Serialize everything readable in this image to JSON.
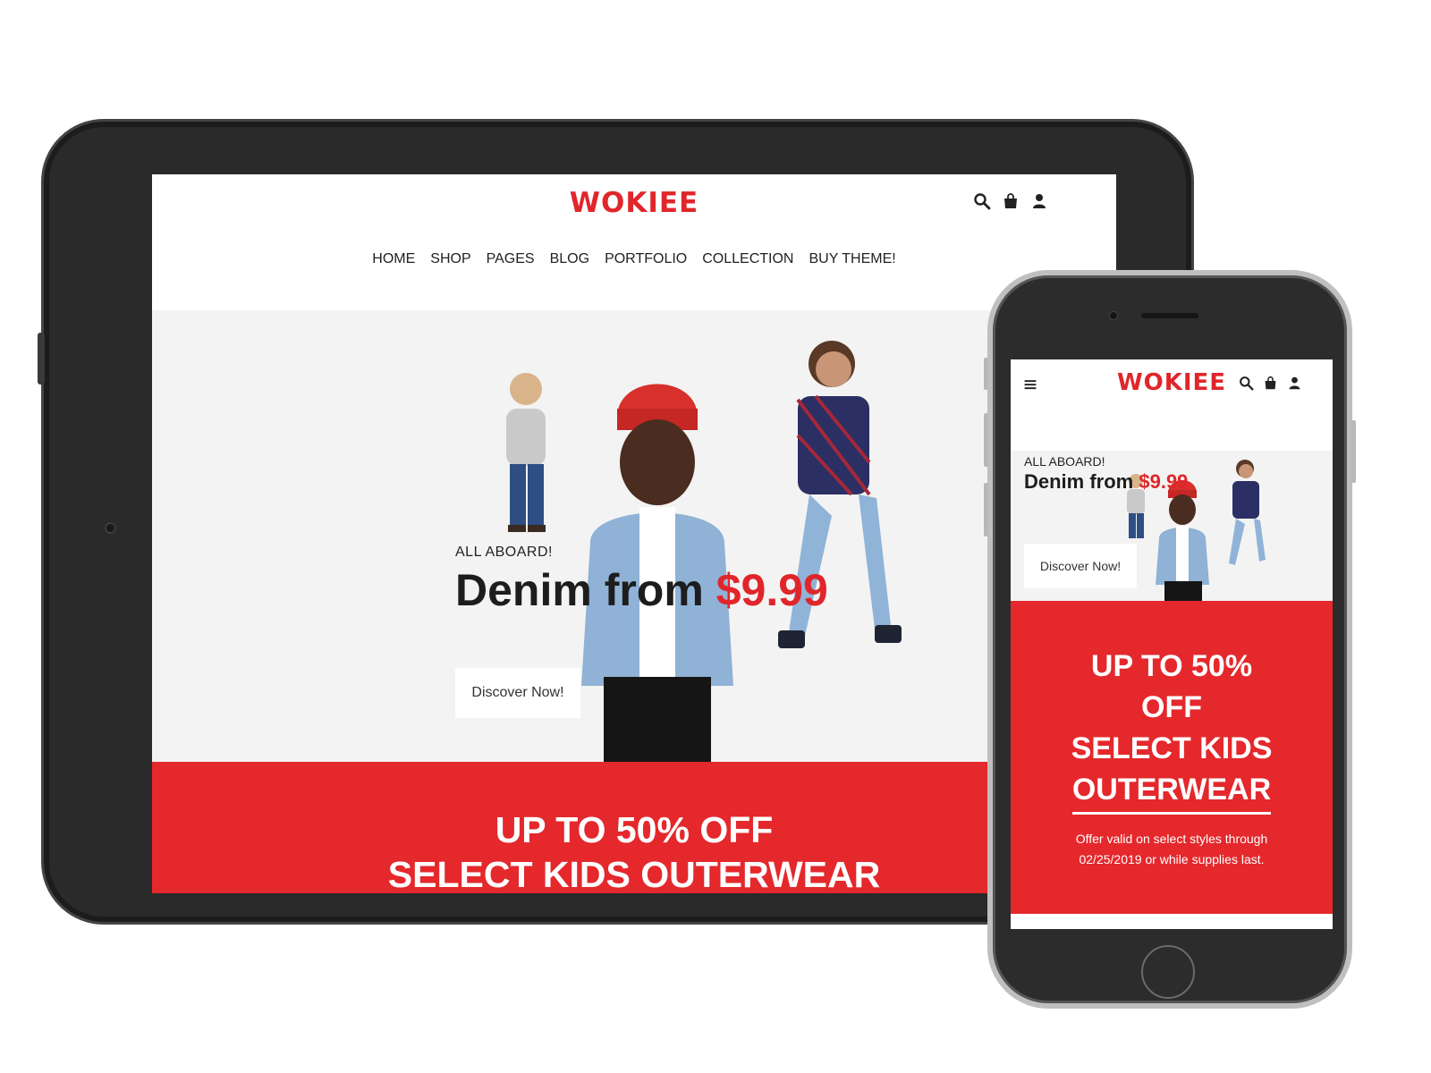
{
  "colors": {
    "brand": "#e0262b",
    "promo_bg": "#e4282c",
    "device_frame": "#2a2a2a",
    "hero_bg": "#f3f3f3"
  },
  "tablet": {
    "logo": "WOKIEE",
    "icons": [
      "search-icon",
      "shopping-bag-icon",
      "user-icon"
    ],
    "nav": [
      "HOME",
      "SHOP",
      "PAGES",
      "BLOG",
      "PORTFOLIO",
      "COLLECTION",
      "BUY THEME!"
    ],
    "hero": {
      "eyebrow": "ALL ABOARD!",
      "headline": "Denim from ",
      "price": "$9.99",
      "button": "Discover Now!"
    },
    "promo": {
      "line1": "UP TO 50% OFF",
      "line2": "SELECT KIDS OUTERWEAR"
    }
  },
  "phone": {
    "logo": "WOKIEE",
    "icons": [
      "menu-icon",
      "search-icon",
      "shopping-bag-icon",
      "user-icon"
    ],
    "hero": {
      "eyebrow": "ALL ABOARD!",
      "headline": "Denim from ",
      "price": "$9.99",
      "button": "Discover Now!"
    },
    "promo": {
      "line1": "UP TO 50%",
      "line2": "OFF",
      "line3": "SELECT KIDS",
      "line4": "OUTERWEAR",
      "offer": "Offer valid on select styles through 02/25/2019 or while supplies last."
    }
  }
}
